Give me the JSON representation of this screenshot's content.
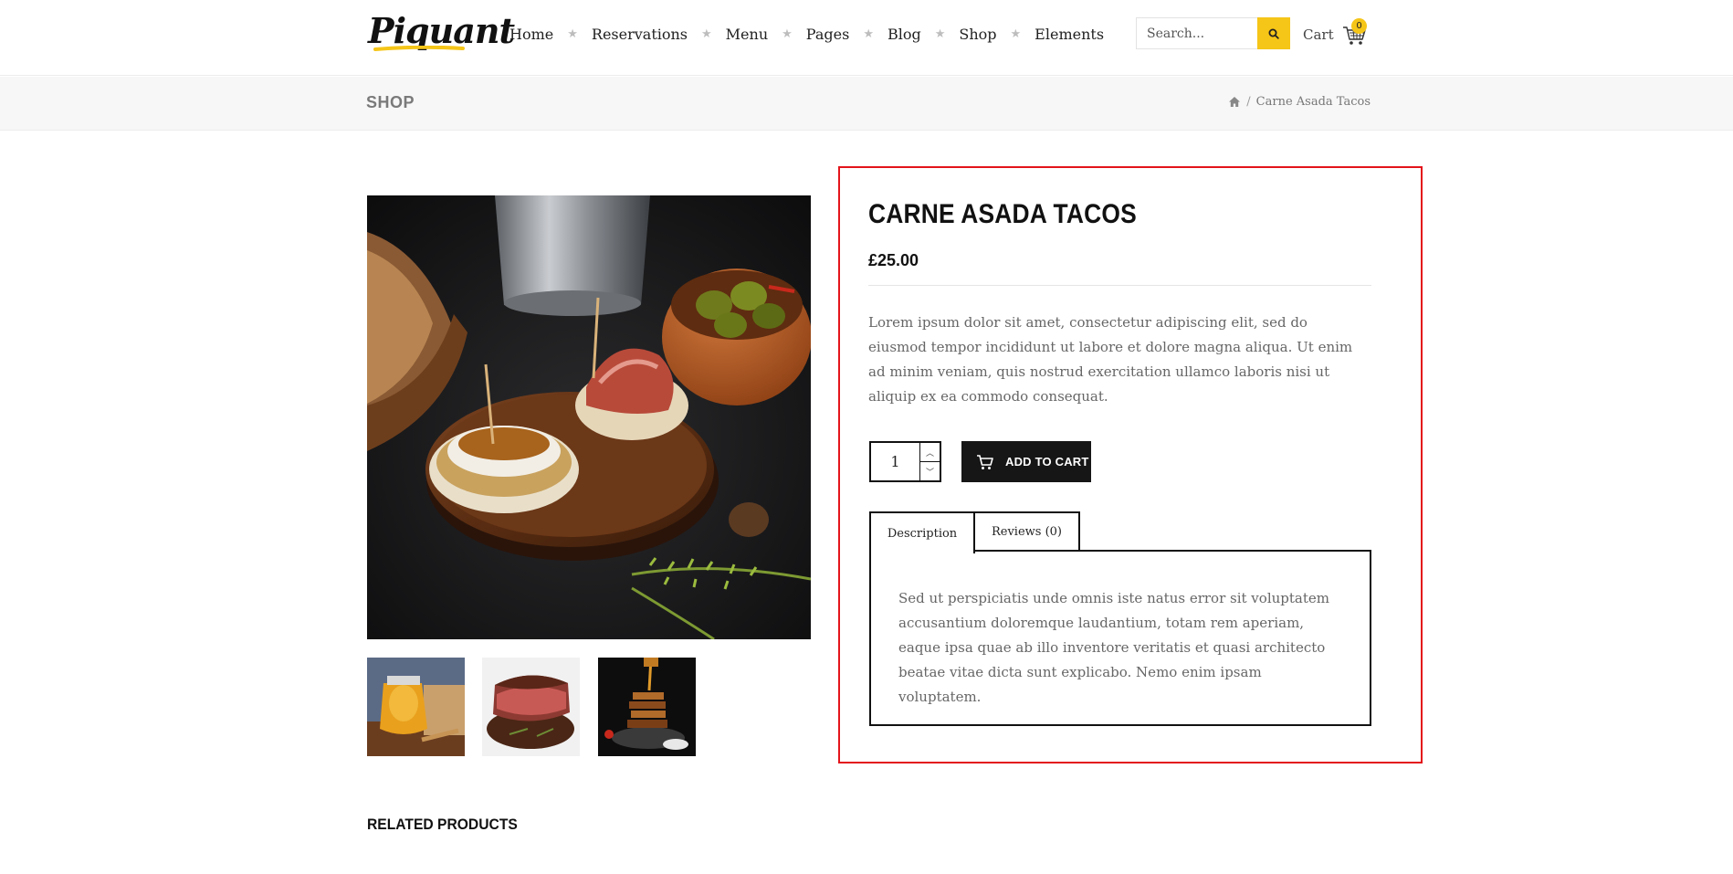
{
  "header": {
    "logo_text": "Piquant",
    "nav": [
      {
        "label": "Home"
      },
      {
        "label": "Reservations"
      },
      {
        "label": "Menu"
      },
      {
        "label": "Pages"
      },
      {
        "label": "Blog"
      },
      {
        "label": "Shop"
      },
      {
        "label": "Elements"
      }
    ],
    "search": {
      "placeholder": "Search...",
      "icon": "search-icon"
    },
    "cart": {
      "label": "Cart",
      "count": "0",
      "icon": "basket-icon"
    }
  },
  "titlebar": {
    "title": "SHOP",
    "breadcrumb": {
      "home_icon": "home-icon",
      "separator": "/",
      "current": "Carne Asada Tacos"
    }
  },
  "product": {
    "title": "CARNE ASADA TACOS",
    "price": "£25.00",
    "short_description": "Lorem ipsum dolor sit amet, consectetur adipiscing elit, sed do eiusmod tempor incididunt ut labore et dolore magna aliqua. Ut enim ad minim veniam, quis nostrud exercitation ullamco laboris nisi ut aliquip ex ea commodo consequat.",
    "quantity": "1",
    "add_to_cart_label": "ADD TO CART",
    "tabs": [
      {
        "label": "Description",
        "active": true
      },
      {
        "label": "Reviews (0)",
        "active": false
      }
    ],
    "description": "Sed ut perspiciatis unde omnis iste natus error sit voluptatem accusantium doloremque laudantium, totam rem aperiam, eaque ipsa quae ab illo inventore veritatis et quasi architecto beatae vitae dicta sunt explicabo. Nemo enim ipsam voluptatem."
  },
  "related": {
    "title": "RELATED PRODUCTS"
  },
  "colors": {
    "accent": "#f5c518",
    "dark": "#161616",
    "highlight": "#e3141b"
  }
}
